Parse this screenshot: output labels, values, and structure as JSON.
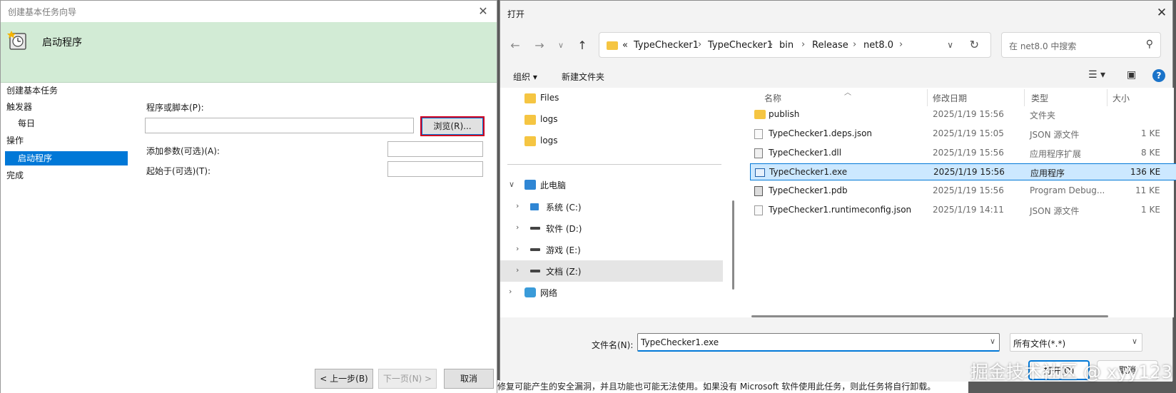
{
  "wizard": {
    "title": "创建基本任务向导",
    "header_title": "启动程序",
    "steps_title": "创建基本任务",
    "steps": [
      "触发器",
      "每日",
      "操作",
      "启动程序",
      "完成"
    ],
    "program_label": "程序或脚本(P):",
    "program_value": "",
    "browse_label": "浏览(R)...",
    "args_label": "添加参数(可选)(A):",
    "start_in_label": "起始于(可选)(T):",
    "back_label": "< 上一步(B)",
    "next_label": "下一页(N) >",
    "cancel_label": "取消"
  },
  "background_text": "修复可能产生的安全漏洞，并且功能也可能无法使用。如果没有 Microsoft 软件使用此任务，则此任务将自行卸载。",
  "dialog": {
    "title": "打开",
    "breadcrumb": [
      "«",
      "TypeChecker1",
      "TypeChecker1",
      "bin",
      "Release",
      "net8.0"
    ],
    "search_placeholder": "在 net8.0 中搜索",
    "organize_label": "组织 ▾",
    "new_folder_label": "新建文件夹",
    "nav_items": [
      {
        "label": "Files",
        "icon": "folder-icon"
      },
      {
        "label": "logs",
        "icon": "folder-icon"
      },
      {
        "label": "logs",
        "icon": "folder-icon"
      },
      {
        "label": "此电脑",
        "icon": "computer-icon"
      },
      {
        "label": "系统 (C:)",
        "icon": "drive-icon"
      },
      {
        "label": "软件 (D:)",
        "icon": "drive-icon"
      },
      {
        "label": "游戏 (E:)",
        "icon": "drive-icon"
      },
      {
        "label": "文档 (Z:)",
        "icon": "drive-icon"
      },
      {
        "label": "网络",
        "icon": "network-icon"
      }
    ],
    "columns": [
      "名称",
      "修改日期",
      "类型",
      "大小"
    ],
    "files": [
      {
        "name": "publish",
        "date": "2025/1/19 15:56",
        "type": "文件夹",
        "size": "",
        "icon": "folder-icon"
      },
      {
        "name": "TypeChecker1.deps.json",
        "date": "2025/1/19 15:05",
        "type": "JSON 源文件",
        "size": "1 KE",
        "icon": "file-icon"
      },
      {
        "name": "TypeChecker1.dll",
        "date": "2025/1/19 15:56",
        "type": "应用程序扩展",
        "size": "8 KE",
        "icon": "dll-icon"
      },
      {
        "name": "TypeChecker1.exe",
        "date": "2025/1/19 15:56",
        "type": "应用程序",
        "size": "136 KE",
        "icon": "exe-icon"
      },
      {
        "name": "TypeChecker1.pdb",
        "date": "2025/1/19 15:56",
        "type": "Program Debug...",
        "size": "11 KE",
        "icon": "pdb-icon"
      },
      {
        "name": "TypeChecker1.runtimeconfig.json",
        "date": "2025/1/19 14:11",
        "type": "JSON 源文件",
        "size": "1 KE",
        "icon": "file-icon"
      }
    ],
    "filename_label": "文件名(N):",
    "filename_value": "TypeChecker1.exe",
    "filetype_value": "所有文件(*.*)",
    "open_label": "打开(O)",
    "cancel_label": "取消"
  },
  "watermark": "掘金技术社区 @ xyy123",
  "colors": {
    "accent": "#0078d7",
    "header_green": "#d2ebd5",
    "folder": "#f5c542",
    "selection": "#cce8ff"
  }
}
